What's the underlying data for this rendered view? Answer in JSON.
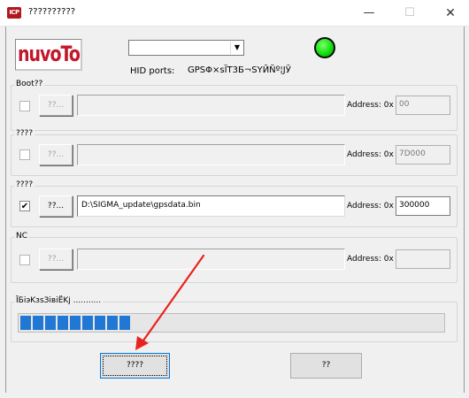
{
  "window": {
    "title": "??????????",
    "app_icon_text": "ICP",
    "minimize_glyph": "—",
    "maximize_glyph": "☐",
    "close_glyph": "✕"
  },
  "logo": {
    "text": "nuvoTon"
  },
  "hid": {
    "selected_value": "",
    "dropdown_glyph": "▼",
    "label": "HID ports:",
    "info": "GPSΦ×sÏT3Б¬SYЙÑº¦ЈЎ"
  },
  "status_led": {
    "color": "#11e00c",
    "state": "connected"
  },
  "groups": [
    {
      "legend": "Boot??",
      "checked": false,
      "enabled": false,
      "browse_label": "??...",
      "path": "",
      "address_label": "Address: 0x",
      "address": "00"
    },
    {
      "legend": "????",
      "checked": false,
      "enabled": false,
      "browse_label": "??...",
      "path": "",
      "address_label": "Address: 0x",
      "address": "7D000"
    },
    {
      "legend": "????",
      "checked": true,
      "enabled": true,
      "browse_label": "??...",
      "path": "D:\\SIGMA_update\\gpsdata.bin",
      "address_label": "Address: 0x",
      "address": "300000"
    },
    {
      "legend": "NC",
      "checked": false,
      "enabled": false,
      "browse_label": "??...",
      "path": "",
      "address_label": "Address: 0x",
      "address": ""
    }
  ],
  "checkbox_glyph": "✔",
  "progress": {
    "legend": "ÏБiэKзsЗiвiЁKј ...........",
    "filled_segments": 9,
    "color": "#2177d4"
  },
  "buttons": {
    "program": "????",
    "exit": "??"
  },
  "annotation": {
    "color": "#e8231d"
  }
}
